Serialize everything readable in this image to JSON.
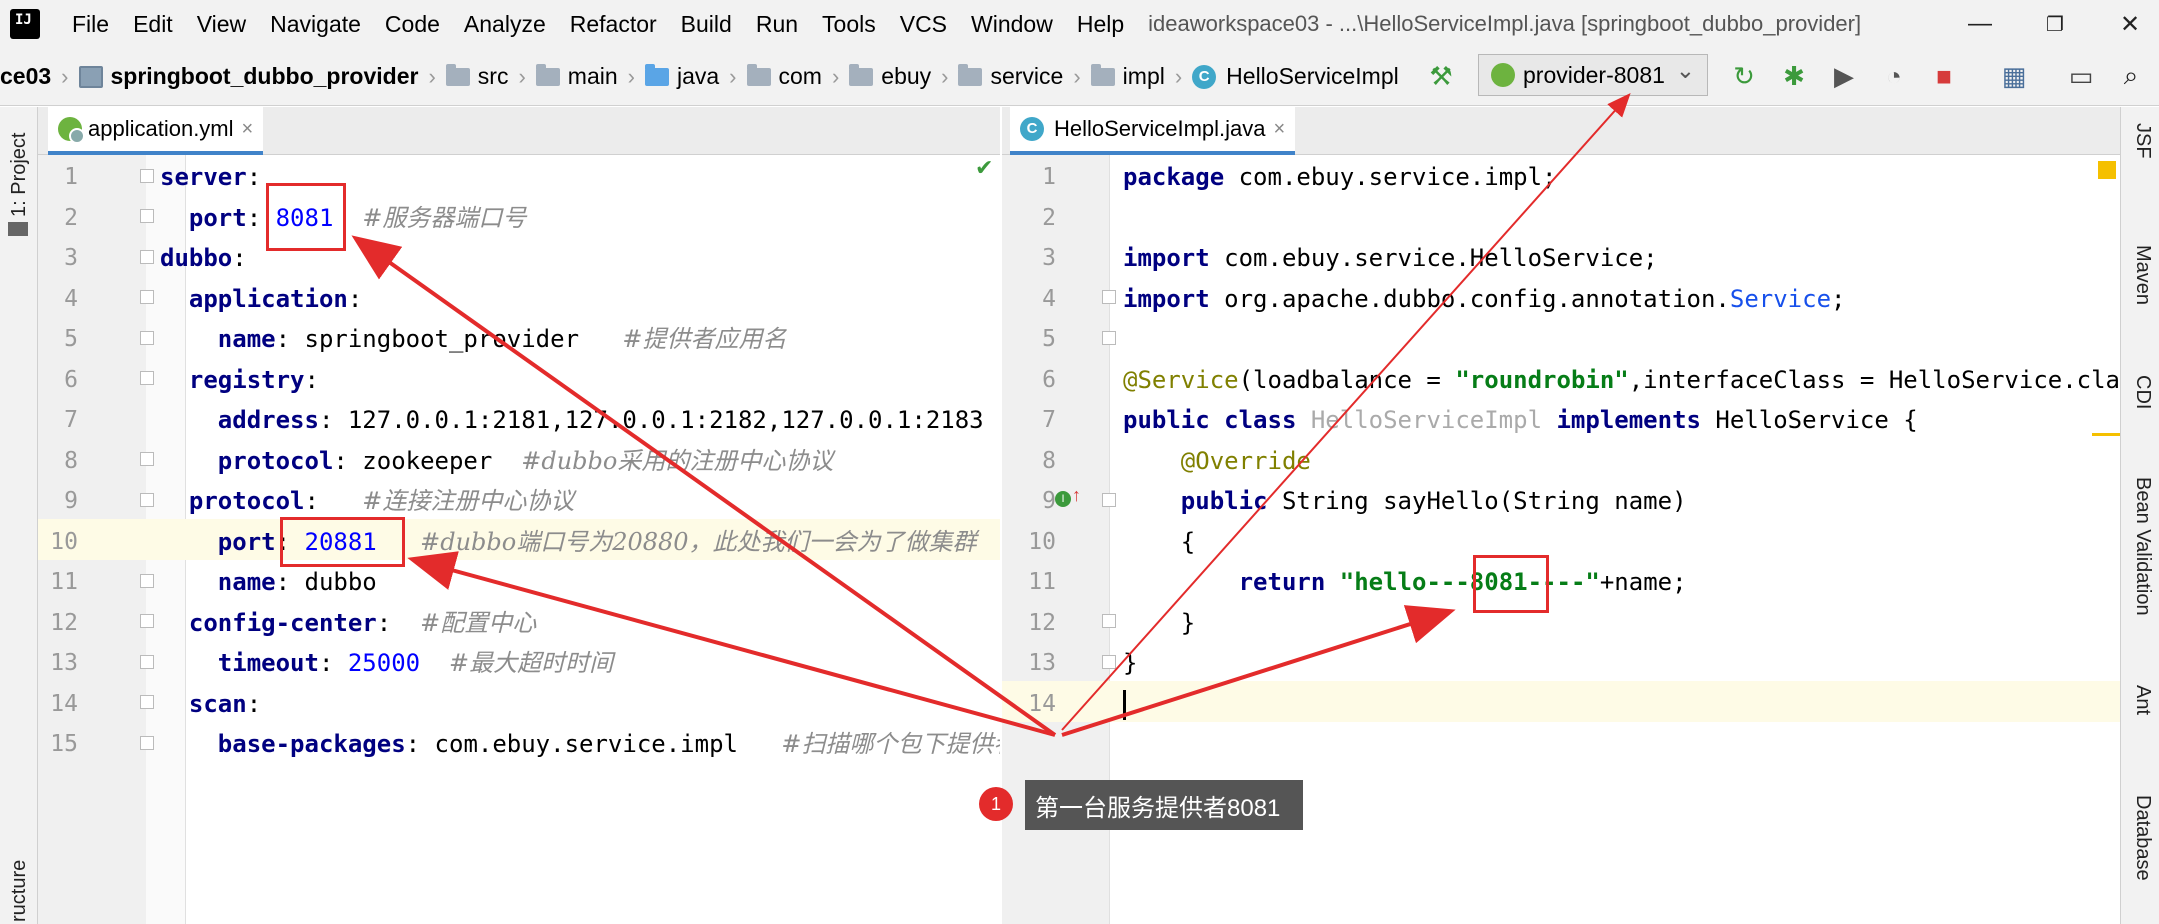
{
  "app": {
    "icon_label": "IJ"
  },
  "menu": [
    "File",
    "Edit",
    "View",
    "Navigate",
    "Code",
    "Analyze",
    "Refactor",
    "Build",
    "Run",
    "Tools",
    "VCS",
    "Window",
    "Help"
  ],
  "window_title": "ideaworkspace03 - ...\\HelloServiceImpl.java [springboot_dubbo_provider]",
  "window_controls": {
    "minimize": "—",
    "restore": "❐",
    "close": "✕"
  },
  "breadcrumbs": {
    "project": "ce03",
    "module": "springboot_dubbo_provider",
    "path": [
      "src",
      "main",
      "java",
      "com",
      "ebuy",
      "service",
      "impl"
    ],
    "file": "HelloServiceImpl"
  },
  "run_config": {
    "label": "provider-8081",
    "arrow": "⌄"
  },
  "left_strip": {
    "project": "1: Project",
    "structure": "ructure"
  },
  "right_strip": [
    "JSF",
    "Maven",
    "CDI",
    "Bean Validation",
    "Ant",
    "Database"
  ],
  "tabs": {
    "left": {
      "label": "application.yml",
      "close": "×"
    },
    "right": {
      "label": "HelloServiceImpl.java",
      "close": "×",
      "icon": "C"
    }
  },
  "left_editor": {
    "line_numbers": [
      "1",
      "2",
      "3",
      "4",
      "5",
      "6",
      "7",
      "8",
      "9",
      "10",
      "11",
      "12",
      "13",
      "14",
      "15"
    ],
    "highlight_line": 10
  },
  "right_editor": {
    "line_numbers": [
      "1",
      "2",
      "3",
      "4",
      "5",
      "6",
      "7",
      "8",
      "9",
      "10",
      "11",
      "12",
      "13",
      "14"
    ],
    "highlight_line": 14
  },
  "tooltip": {
    "badge": "1",
    "text": "第一台服务提供者8081"
  },
  "colors": {
    "annotation_red": "#e32b2b",
    "tab_accent": "#4083c9",
    "highlight": "#fefbe6"
  }
}
